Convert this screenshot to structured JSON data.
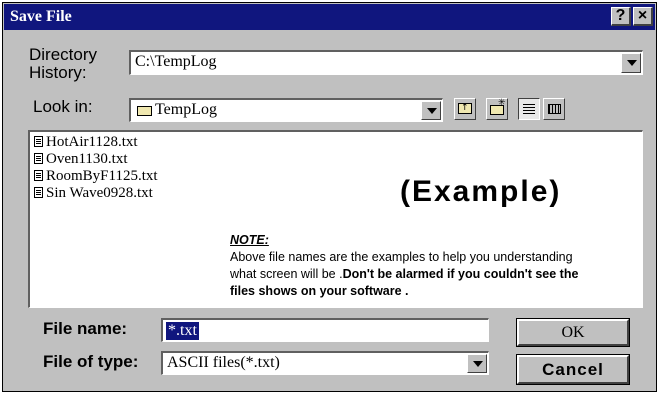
{
  "window": {
    "title": "Save File",
    "help_label": "?",
    "close_label": "×"
  },
  "directory_history": {
    "label_line1": "Directory",
    "label_line2": "History:",
    "value": "C:\\TempLog"
  },
  "look_in": {
    "label": "Look in:",
    "value": "TempLog"
  },
  "files": [
    {
      "name": "HotAir1128.txt"
    },
    {
      "name": "Oven1130.txt"
    },
    {
      "name": "RoomByF1125.txt"
    },
    {
      "name": "Sin Wave0928.txt"
    }
  ],
  "overlay": {
    "example_text": "(Example)",
    "note_title": "NOTE:",
    "note_line1": "Above file names are the examples to help you understanding",
    "note_line2_plain": "what screen will be .",
    "note_line2_bold": "Don't be alarmed if you couldn't see the",
    "note_line3_bold": "files shows on your software ."
  },
  "file_name": {
    "label": "File name:",
    "value": "*.txt"
  },
  "file_type": {
    "label": "File of type:",
    "value": "ASCII files(*.txt)"
  },
  "buttons": {
    "ok": "OK",
    "cancel": "Cancel"
  },
  "colors": {
    "titlebar": "#10167e",
    "face": "#c0c0c0",
    "selection": "#10167e"
  },
  "icons": [
    "folder-icon",
    "up-one-level-icon",
    "new-folder-icon",
    "list-view-icon",
    "details-view-icon",
    "text-file-icon"
  ]
}
